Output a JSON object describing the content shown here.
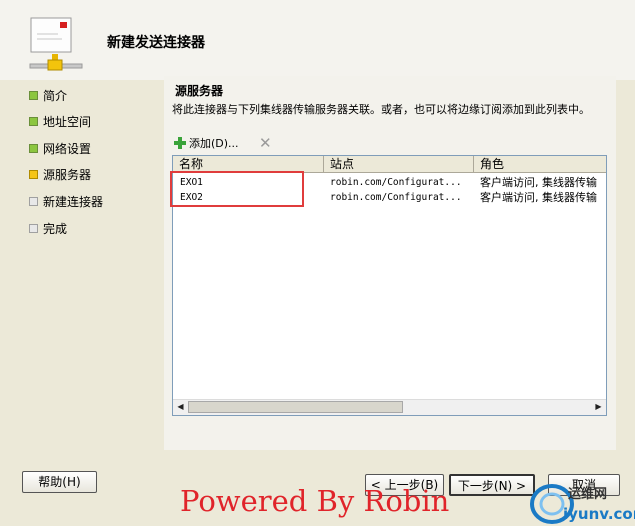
{
  "wizard": {
    "title": "新建发送连接器"
  },
  "steps": [
    {
      "label": "简介",
      "state": "done"
    },
    {
      "label": "地址空间",
      "state": "done"
    },
    {
      "label": "网络设置",
      "state": "done"
    },
    {
      "label": "源服务器",
      "state": "current"
    },
    {
      "label": "新建连接器",
      "state": "pending"
    },
    {
      "label": "完成",
      "state": "pending"
    }
  ],
  "page": {
    "section_title": "源服务器",
    "description": "将此连接器与下列集线器传输服务器关联。或者，也可以将边缘订阅添加到此列表中。",
    "add_label": "添加(D)...",
    "delete_icon": "x-icon"
  },
  "table": {
    "columns": [
      "名称",
      "站点",
      "角色"
    ],
    "rows": [
      {
        "name": "EXO1",
        "site": "robin.com/Configurat...",
        "role": "客户端访问, 集线器传输"
      },
      {
        "name": "EXO2",
        "site": "robin.com/Configurat...",
        "role": "客户端访问, 集线器传输"
      }
    ]
  },
  "buttons": {
    "help": "帮助(H)",
    "back": "< 上一步(B)",
    "next": "下一步(N) >",
    "cancel": "取消"
  },
  "watermark": "Powered By Robin",
  "logo": {
    "line1": "运维网",
    "line2": "iyunv.com"
  },
  "colors": {
    "highlight": "#e03c3c",
    "watermark": "#e0242a",
    "done": "#8cc63f",
    "current": "#f5c518"
  }
}
